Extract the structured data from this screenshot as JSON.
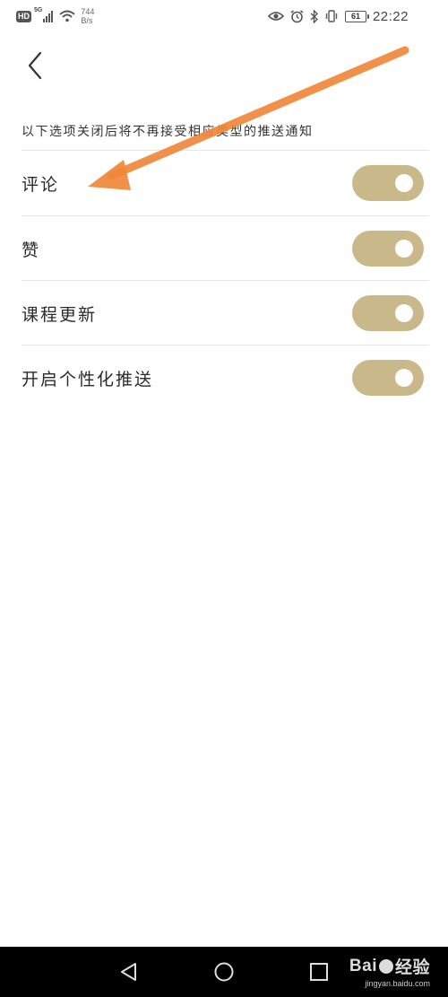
{
  "status_bar": {
    "hd": "HD",
    "network": "5G",
    "speed_value": "744",
    "speed_unit": "B/s",
    "battery": "61",
    "time": "22:22",
    "icons": [
      "eye-icon",
      "alarm-icon",
      "bluetooth-icon",
      "vibrate-icon"
    ]
  },
  "header": {
    "back_icon": "chevron-left-icon"
  },
  "description": "以下选项关闭后将不再接受相应类型的推送通知",
  "settings": [
    {
      "label": "评论",
      "on": true
    },
    {
      "label": "赞",
      "on": true
    },
    {
      "label": "课程更新",
      "on": true
    },
    {
      "label": "开启个性化推送",
      "on": true
    }
  ],
  "colors": {
    "toggle_on": "#c9b98a",
    "annotation_arrow": "#f0883a",
    "navbar": "#000000"
  },
  "navbar": {
    "icons": [
      "back-triangle-icon",
      "home-circle-icon",
      "recents-square-icon"
    ]
  },
  "watermark": {
    "brand_left": "Bai",
    "brand_right": "经验",
    "url": "jingyan.baidu.com"
  }
}
